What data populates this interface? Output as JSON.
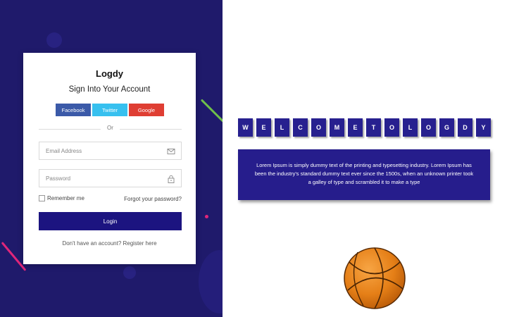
{
  "login_card": {
    "brand": "Logdy",
    "subtitle": "Sign Into Your Account",
    "social": {
      "facebook": "Facebook",
      "twitter": "Twitter",
      "google": "Google"
    },
    "divider_text": "Or",
    "email": {
      "placeholder": "Email Address",
      "value": "",
      "icon": "envelope-icon"
    },
    "password": {
      "placeholder": "Password",
      "value": "",
      "icon": "lock-icon"
    },
    "remember_label": "Remember me",
    "remember_checked": false,
    "forgot_label": "Forgot your password?",
    "login_label": "Login",
    "register_prompt": "Don't have an account?",
    "register_link": "Register here"
  },
  "welcome": {
    "letters": [
      "W",
      "E",
      "L",
      "C",
      "O",
      "M",
      "E",
      "T",
      "O",
      "L",
      "O",
      "G",
      "D",
      "Y"
    ]
  },
  "info": {
    "text": "Lorem Ipsum is simply dummy text of the printing and typesetting industry. Lorem Ipsum has been the industry's standard dummy text ever since the 1500s, when an unknown printer took a galley of type and scrambled it to make a type"
  },
  "colors": {
    "panel_bg": "#1f1a6b",
    "primary": "#1c1480",
    "tile": "#27208f",
    "facebook": "#3b5aa8",
    "twitter": "#37c0ef",
    "google": "#df3e33",
    "ball": "#e57f17"
  }
}
